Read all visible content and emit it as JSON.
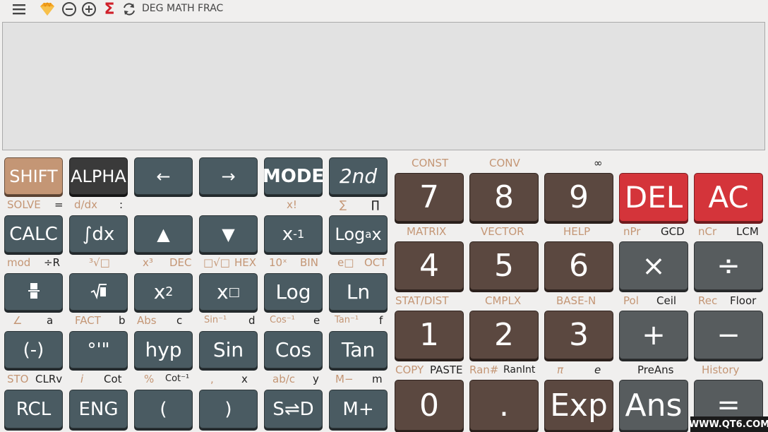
{
  "toolbar": {
    "modes": [
      "DEG",
      "MATH",
      "FRAC"
    ],
    "icons": [
      "menu-icon",
      "gem-icon",
      "zoom-out-icon",
      "zoom-in-icon",
      "sigma-icon",
      "refresh-icon"
    ],
    "colors": {
      "gem": "#f5a623",
      "sigma": "#d0202a"
    }
  },
  "display": {
    "expression": "",
    "result": ""
  },
  "left_keys": {
    "row1": [
      "SHIFT",
      "ALPHA",
      "←",
      "→",
      "MODE",
      "2nd"
    ],
    "row2": [
      "CALC",
      "∫dx",
      "▲",
      "▼",
      "x",
      "Log"
    ],
    "row2_sup": {
      "x_power": "-1",
      "log_base": "a",
      "log_arg": "x"
    },
    "row3": [
      "",
      "",
      "x",
      "x",
      "Log",
      "Ln"
    ],
    "row3_sup": {
      "square": "2",
      "box": "□"
    },
    "row4": [
      "(-)",
      "°'\"",
      "hyp",
      "Sin",
      "Cos",
      "Tan"
    ],
    "row5": [
      "RCL",
      "ENG",
      "(",
      ")",
      "S⇌D",
      "M+"
    ]
  },
  "left_labels": {
    "row1": [
      "SOLVE",
      "=",
      "d/dx",
      ":",
      "x!",
      "∑",
      "∏"
    ],
    "row2": [
      "mod",
      "÷R",
      "³√□",
      "x³",
      "DEC",
      "□√□",
      "HEX",
      "10ˣ",
      "BIN",
      "e□",
      "OCT"
    ],
    "row3": [
      "∠",
      "a",
      "FACT",
      "b",
      "Abs",
      "c",
      "Sin⁻¹",
      "d",
      "Cos⁻¹",
      "e",
      "Tan⁻¹",
      "f"
    ],
    "row4": [
      "STO",
      "CLRv",
      "i",
      "Cot",
      "%",
      "Cot⁻¹",
      ",",
      "x",
      "ab/c",
      "y",
      "M−",
      "m"
    ]
  },
  "right_keys": {
    "row1": [
      "7",
      "8",
      "9",
      "DEL",
      "AC"
    ],
    "row2": [
      "4",
      "5",
      "6",
      "×",
      "÷"
    ],
    "row3": [
      "1",
      "2",
      "3",
      "+",
      "−"
    ],
    "row4": [
      "0",
      ".",
      "Exp",
      "Ans",
      "="
    ]
  },
  "right_labels": {
    "row0": [
      "CONST",
      "CONV",
      "∞"
    ],
    "row1": [
      "MATRIX",
      "VECTOR",
      "HELP",
      "nPr",
      "GCD",
      "nCr",
      "LCM"
    ],
    "row2": [
      "STAT/DIST",
      "CMPLX",
      "BASE-N",
      "Pol",
      "Ceil",
      "Rec",
      "Floor"
    ],
    "row3": [
      "COPY",
      "PASTE",
      "Ran#",
      "RanInt",
      "π",
      "e",
      "PreAns",
      "History"
    ]
  },
  "watermark": "WWW.QT6.COM"
}
